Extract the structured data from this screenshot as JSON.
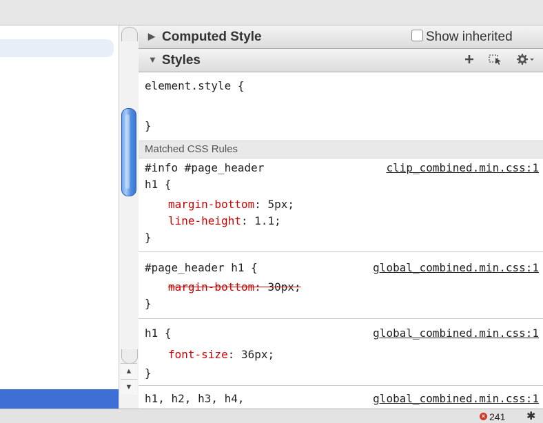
{
  "computed_style": {
    "title": "Computed Style",
    "show_inherited_label": "Show inherited",
    "show_inherited_checked": false
  },
  "styles": {
    "title": "Styles",
    "add_icon": "plus-icon",
    "select_icon": "element-select-icon",
    "gear_icon": "gear-icon"
  },
  "element_style": {
    "line1": "element.style {",
    "line2": "}"
  },
  "matched_header": "Matched CSS Rules",
  "rules": [
    {
      "selector": "#info #page_header",
      "selector2": "h1 {",
      "source": "clip_combined.min.css:1",
      "props": [
        {
          "name": "margin-bottom",
          "value": "5px;"
        },
        {
          "name": "line-height",
          "value": "1.1;"
        }
      ],
      "close": "}"
    },
    {
      "selector": "#page_header h1 {",
      "source": "global_combined.min.css:1",
      "props": [
        {
          "name": "margin-bottom",
          "value": "30px;",
          "overridden": true
        }
      ],
      "close": "}"
    },
    {
      "selector": "h1 {",
      "source": "global_combined.min.css:1",
      "props": [
        {
          "name": "font-size",
          "value": "36px;"
        }
      ],
      "close": "}"
    },
    {
      "selector": "h1, h2, h3, h4,",
      "source": "global_combined.min.css:1"
    }
  ],
  "status": {
    "error_count": "241",
    "error_icon": "error-icon"
  },
  "colors": {
    "property": "#c80000",
    "selection": "#3d6fd4",
    "scroll_thumb": "#4f8ce0"
  }
}
